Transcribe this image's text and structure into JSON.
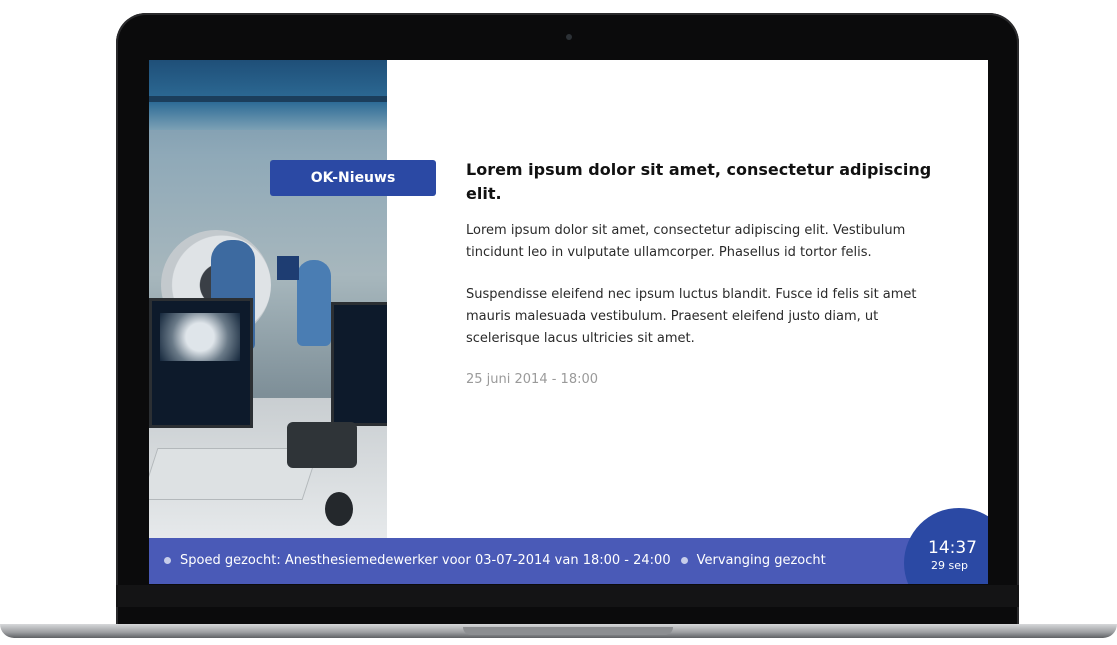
{
  "section_badge": "OK-Nieuws",
  "article": {
    "title": "Lorem ipsum dolor sit amet, consectetur adipiscing elit.",
    "paragraphs": [
      "Lorem ipsum dolor sit amet, consectetur adipiscing elit. Vestibulum tincidunt leo in vulputate ullamcorper. Phasellus id tortor felis.",
      "Suspendisse eleifend nec ipsum luctus blandit. Fusce id felis sit amet mauris malesuada vestibulum. Praesent eleifend justo diam, ut scelerisque lacus ultricies sit amet."
    ],
    "date": "25 juni 2014 - 18:00"
  },
  "ticker": {
    "arrow": "‹",
    "items": [
      "Spoed gezocht: Anesthesiemedewerker voor 03-07-2014 van 18:00 - 24:00",
      "Vervanging gezocht"
    ]
  },
  "clock": {
    "time": "14:37",
    "date": "29 sep"
  },
  "colors": {
    "accent": "#2b49a4",
    "ticker_bg": "#4a5ab7"
  }
}
